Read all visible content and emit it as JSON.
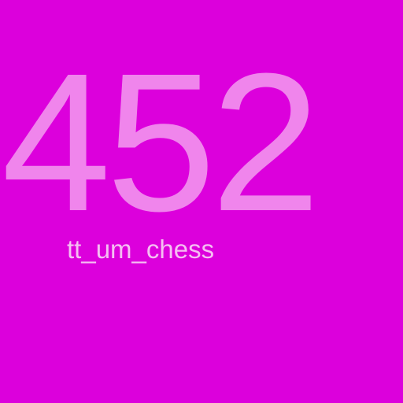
{
  "display": {
    "number": "452",
    "label": "tt_um_chess"
  },
  "colors": {
    "background": "#dc00dc",
    "number": "#f085ec",
    "label": "#f5bff2"
  }
}
